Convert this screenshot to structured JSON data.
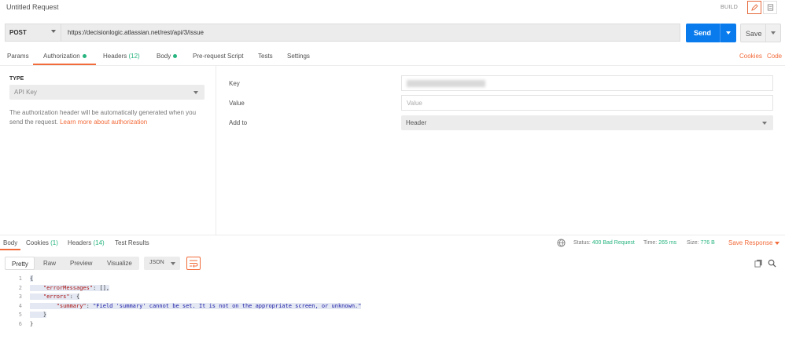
{
  "header": {
    "title": "Untitled Request",
    "build_label": "BUILD"
  },
  "request": {
    "method": "POST",
    "url": "https://decisionlogic.atlassian.net/rest/api/3/issue",
    "send_label": "Send",
    "save_label": "Save"
  },
  "request_tabs": [
    {
      "label": "Params"
    },
    {
      "label": "Authorization"
    },
    {
      "label": "Headers",
      "count": "(12)"
    },
    {
      "label": "Body"
    },
    {
      "label": "Pre-request Script"
    },
    {
      "label": "Tests"
    },
    {
      "label": "Settings"
    }
  ],
  "request_links": {
    "cookies": "Cookies",
    "code": "Code"
  },
  "auth": {
    "type_label": "TYPE",
    "type_value": "API Key",
    "note": "The authorization header will be automatically generated when you send the request.",
    "learn_more": "Learn more about authorization",
    "key_label": "Key",
    "value_label": "Value",
    "value_placeholder": "Value",
    "add_to_label": "Add to",
    "add_to_value": "Header"
  },
  "response_tabs": [
    {
      "label": "Body"
    },
    {
      "label": "Cookies",
      "count": "(1)"
    },
    {
      "label": "Headers",
      "count": "(14)"
    },
    {
      "label": "Test Results"
    }
  ],
  "response_status": {
    "status_label": "Status:",
    "status_value": "400 Bad Request",
    "time_label": "Time:",
    "time_value": "265 ms",
    "size_label": "Size:",
    "size_value": "776 B",
    "save_response": "Save Response"
  },
  "format": {
    "pretty": "Pretty",
    "raw": "Raw",
    "preview": "Preview",
    "visualize": "Visualize",
    "lang": "JSON"
  },
  "code": {
    "line_numbers": [
      "1",
      "2",
      "3",
      "4",
      "5",
      "6"
    ],
    "l1": "{",
    "l2_key": "\"errorMessages\"",
    "l2_rest": ": [],",
    "l3_key": "\"errors\"",
    "l3_rest": ": {",
    "l4_key": "\"summary\"",
    "l4_sep": ": ",
    "l4_val": "\"Field 'summary' cannot be set. It is not on the appropriate screen, or unknown.\"",
    "l5": "}",
    "l6": "}"
  },
  "colors": {
    "accent": "#f26b3a",
    "primary": "#097bed",
    "success": "#26b47f"
  }
}
